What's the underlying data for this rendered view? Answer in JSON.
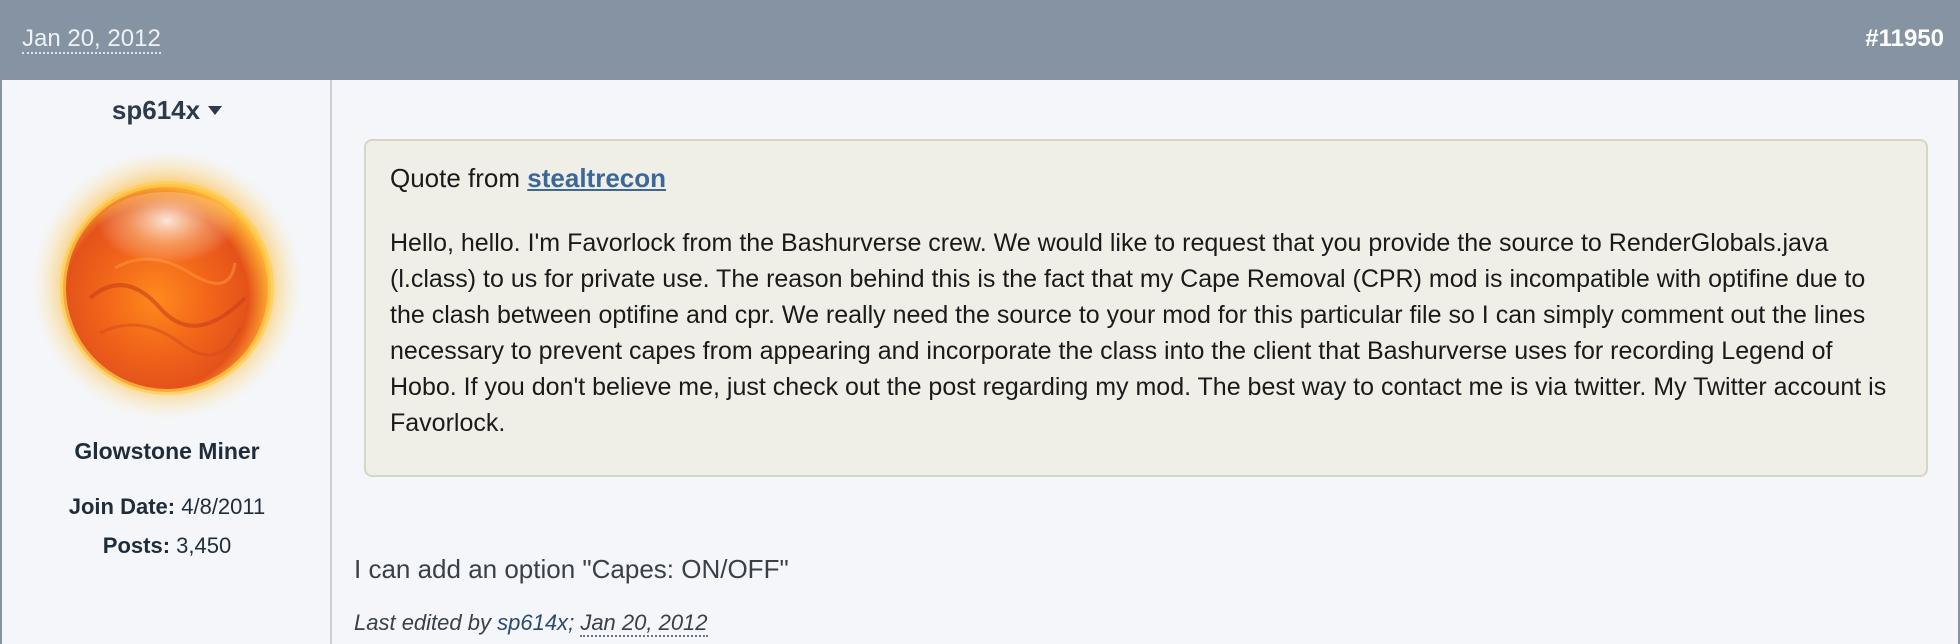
{
  "post": {
    "date": "Jan 20, 2012",
    "number": "#11950"
  },
  "user": {
    "name": "sp614x",
    "title": "Glowstone Miner",
    "join_date_label": "Join Date:",
    "join_date": "4/8/2011",
    "posts_label": "Posts:",
    "posts": "3,450",
    "avatar_icon": "glowing-sun-orb-icon"
  },
  "quote": {
    "prefix": "Quote from",
    "author": "stealtrecon",
    "body": "Hello, hello. I'm Favorlock from the Bashurverse crew. We would like to request that you provide the source to RenderGlobals.java (l.class) to us for private use. The reason behind this is the fact that my Cape Removal (CPR) mod is incompatible with optifine due to the clash between optifine and cpr. We really need the source to your mod for this particular file so I can simply comment out the lines necessary to prevent capes from appearing and incorporate the class into the client that Bashurverse uses for recording Legend of Hobo. If you don't believe me, just check out the post regarding my mod. The best way to contact me is via twitter. My Twitter account is Favorlock."
  },
  "reply": {
    "text": "I can add an option \"Capes: ON/OFF\""
  },
  "edited": {
    "prefix": "Last edited by",
    "by": "sp614x",
    "separator": ";",
    "date": "Jan 20, 2012"
  },
  "colors": {
    "header_bg": "#8593a3",
    "quote_bg": "#efefe7",
    "link": "#3c6898"
  }
}
